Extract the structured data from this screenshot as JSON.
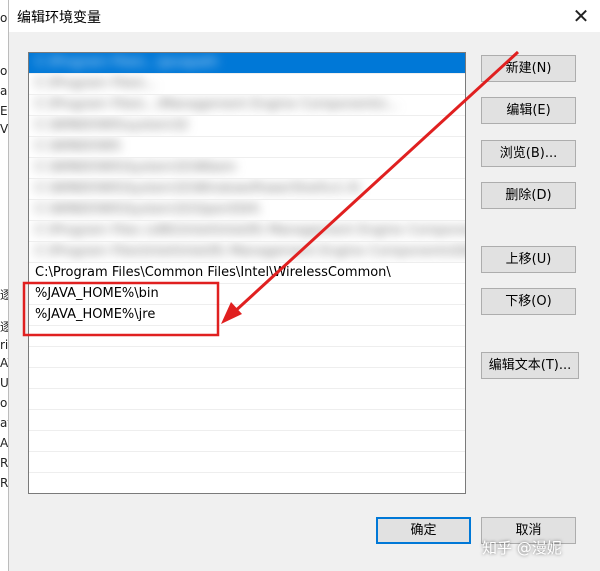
{
  "dialog": {
    "title": "编辑环境变量"
  },
  "background_window": {
    "fragments": [
      "o",
      "o",
      "a",
      "E",
      "V",
      "逐",
      "逐",
      "ri",
      "AV",
      "U",
      "oS",
      "at",
      "A",
      "R",
      "R"
    ]
  },
  "list": {
    "items": [
      {
        "text": "C:\\Program Files\\...\\javapath",
        "selected": true,
        "blurred": true
      },
      {
        "text": "C:\\Program Files\\...",
        "selected": false,
        "blurred": true
      },
      {
        "text": "C:\\Program Files\\...\\Management Engine Components\\...",
        "selected": false,
        "blurred": true
      },
      {
        "text": "C:\\WINDOWS\\system32",
        "selected": false,
        "blurred": true
      },
      {
        "text": "C:\\WINDOWS",
        "selected": false,
        "blurred": true
      },
      {
        "text": "C:\\WINDOWS\\System32\\Wbem",
        "selected": false,
        "blurred": true
      },
      {
        "text": "C:\\WINDOWS\\System32\\WindowsPowerShell\\v1.0\\",
        "selected": false,
        "blurred": true
      },
      {
        "text": "C:\\WINDOWS\\System32\\OpenSSH\\",
        "selected": false,
        "blurred": true
      },
      {
        "text": "C:\\Program Files (x86)\\Intel\\Intel(R) Management Engine Componen...",
        "selected": false,
        "blurred": true
      },
      {
        "text": "C:\\Program Files\\Intel\\Intel(R) Management Engine Components\\DAL",
        "selected": false,
        "blurred": true
      },
      {
        "text": "C:\\Program Files\\Common Files\\Intel\\WirelessCommon\\",
        "selected": false,
        "blurred": false
      },
      {
        "text": "%JAVA_HOME%\\bin",
        "selected": false,
        "blurred": false
      },
      {
        "text": "%JAVA_HOME%\\jre",
        "selected": false,
        "blurred": false
      },
      {
        "text": "",
        "selected": false,
        "blurred": false
      },
      {
        "text": "",
        "selected": false,
        "blurred": false
      },
      {
        "text": "",
        "selected": false,
        "blurred": false
      },
      {
        "text": "",
        "selected": false,
        "blurred": false
      },
      {
        "text": "",
        "selected": false,
        "blurred": false
      },
      {
        "text": "",
        "selected": false,
        "blurred": false
      },
      {
        "text": "",
        "selected": false,
        "blurred": false
      },
      {
        "text": "",
        "selected": false,
        "blurred": false
      }
    ]
  },
  "buttons": {
    "new": "新建(N)",
    "edit": "编辑(E)",
    "browse": "浏览(B)...",
    "delete": "删除(D)",
    "move_up": "上移(U)",
    "move_down": "下移(O)",
    "edit_text": "编辑文本(T)...",
    "ok": "确定",
    "cancel": "取消"
  },
  "annotation": {
    "color": "#e02020"
  },
  "watermark": {
    "text": "知乎 @漫妮"
  },
  "colors": {
    "selection": "#0078d7",
    "dialog_bg": "#f0f0f0",
    "annotation_red": "#e02020"
  }
}
